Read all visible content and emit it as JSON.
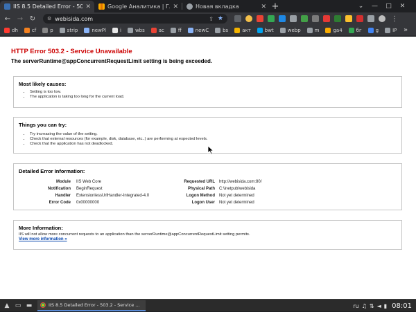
{
  "browser": {
    "tabs": [
      {
        "title": "IIS 8.5 Detailed Error - 503.2 - Ser",
        "active": true,
        "favicon": "iis-icon"
      },
      {
        "title": "Google Аналитика | Главная",
        "active": false,
        "favicon": "analytics-icon"
      },
      {
        "title": "Новая вкладка",
        "active": false,
        "favicon": "chrome-icon"
      }
    ],
    "new_tab_label": "+",
    "address": "webisida.com"
  },
  "bookmarks": [
    {
      "label": "dh",
      "color": "#ff3b30"
    },
    {
      "label": "cf",
      "color": "#f48120"
    },
    {
      "label": "p",
      "color": "#888888"
    },
    {
      "label": "strip",
      "color": "#9aa0a6"
    },
    {
      "label": "newPl",
      "color": "#8ab4f8"
    },
    {
      "label": "i",
      "color": "#e8e8e8"
    },
    {
      "label": "wbs",
      "color": "#9aa0a6"
    },
    {
      "label": "ac",
      "color": "#ea4335"
    },
    {
      "label": "ff",
      "color": "#9aa0a6"
    },
    {
      "label": "newC",
      "color": "#8ab4f8"
    },
    {
      "label": "bs",
      "color": "#9aa0a6"
    },
    {
      "label": "акт",
      "color": "#f4b400"
    },
    {
      "label": "bwt",
      "color": "#00a4ef"
    },
    {
      "label": "webp",
      "color": "#9aa0a6"
    },
    {
      "label": "m",
      "color": "#9aa0a6"
    },
    {
      "label": "ga4",
      "color": "#f9ab00"
    },
    {
      "label": "бг",
      "color": "#34a853"
    },
    {
      "label": "g",
      "color": "#4285f4"
    },
    {
      "label": "IP",
      "color": "#9aa0a6"
    }
  ],
  "page": {
    "error_title": "HTTP Error 503.2 - Service Unavailable",
    "error_subtitle": "The serverRuntime@appConcurrentRequestLimit setting is being exceeded.",
    "causes": {
      "heading": "Most likely causes:",
      "items": [
        "Setting is too low.",
        "The application is taking too long for the current load."
      ]
    },
    "try": {
      "heading": "Things you can try:",
      "items": [
        "Try increasing the value of the setting.",
        "Check that external resources (for example, disk, database, etc..) are performing at expected levels.",
        "Check that the application has not deadlocked."
      ]
    },
    "details": {
      "heading": "Detailed Error Information:",
      "rows": [
        {
          "l1": "Module",
          "v1": "IIS Web Core",
          "l2": "Requested URL",
          "v2": "http://webisida.com:80/"
        },
        {
          "l1": "Notification",
          "v1": "BeginRequest",
          "l2": "Physical Path",
          "v2": "C:\\inetpub\\webisida"
        },
        {
          "l1": "Handler",
          "v1": "ExtensionlessUrlHandler-Integrated-4.0",
          "l2": "Logon Method",
          "v2": "Not yet determined"
        },
        {
          "l1": "Error Code",
          "v1": "0x00000000",
          "l2": "Logon User",
          "v2": "Not yet determined"
        }
      ]
    },
    "more": {
      "heading": "More Information:",
      "text": "IIS will not allow more concurrent requests to an application than the serverRuntime@appConcurrentRequestLimit setting permits.",
      "link": "View more information »"
    }
  },
  "taskbar": {
    "task_title": "IIS 8.5 Detailed Error - 503.2 - Service ...",
    "lang": "ru",
    "clock": "08:01"
  }
}
